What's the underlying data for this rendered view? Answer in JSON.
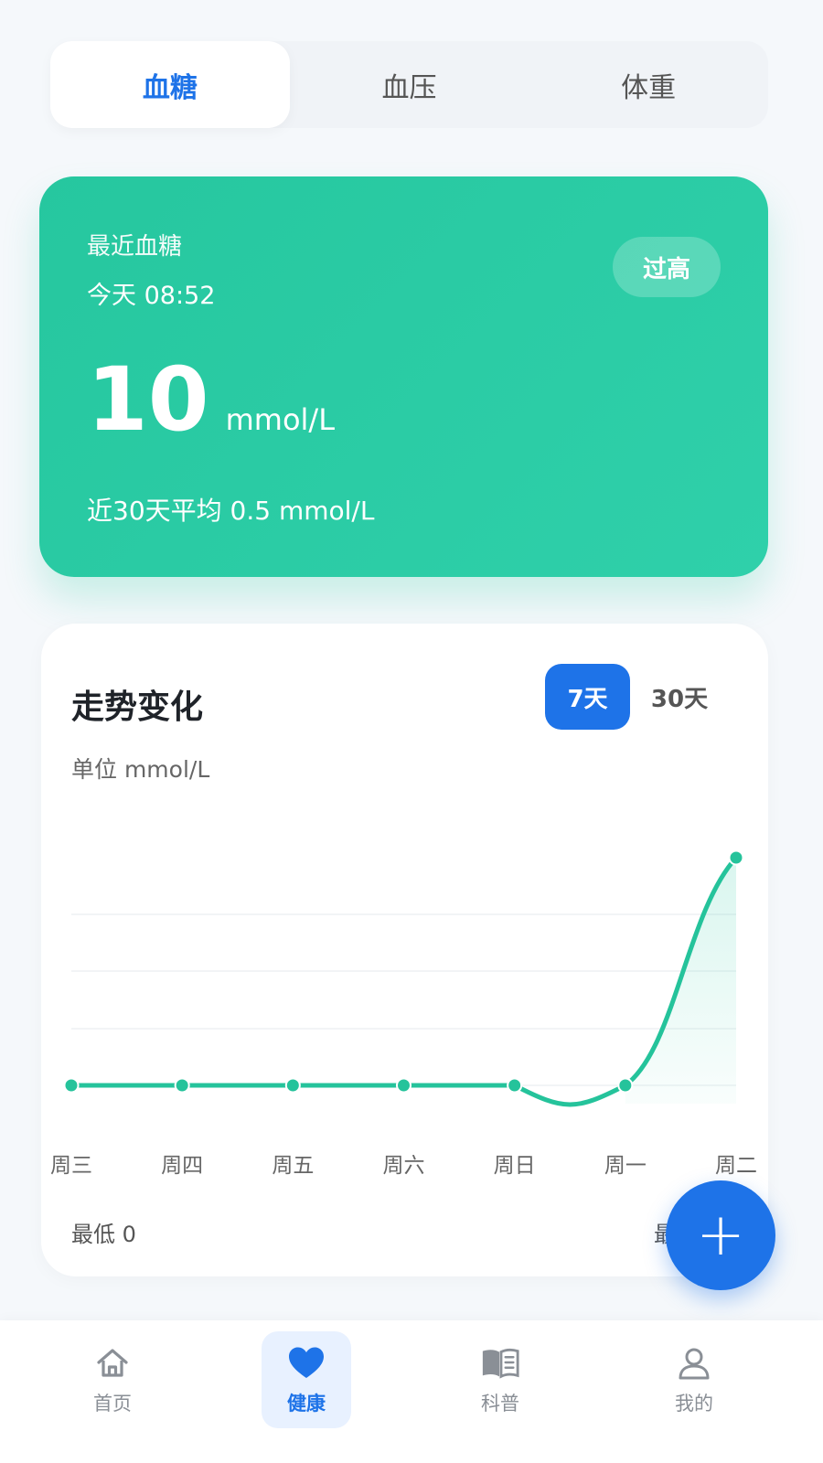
{
  "tabs": [
    {
      "label": "血糖",
      "active": true
    },
    {
      "label": "血压",
      "active": false
    },
    {
      "label": "体重",
      "active": false
    }
  ],
  "hero": {
    "title": "最近血糖",
    "time": "今天 08:52",
    "badge": "过高",
    "value": "10",
    "unit": "mmol/L",
    "average": "近30天平均 0.5 mmol/L"
  },
  "trend": {
    "title": "走势变化",
    "range_7": "7天",
    "range_30": "30天",
    "unit_label": "单位 mmol/L",
    "min_label": "最低 0",
    "max_label": "最"
  },
  "fab": {
    "label": "+"
  },
  "nav": [
    {
      "label": "首页",
      "icon": "home-icon",
      "active": false
    },
    {
      "label": "健康",
      "icon": "heart-icon",
      "active": true
    },
    {
      "label": "科普",
      "icon": "book-icon",
      "active": false
    },
    {
      "label": "我的",
      "icon": "user-icon",
      "active": false
    }
  ],
  "colors": {
    "accent": "#1e73e8",
    "health_green": "#2ecba4",
    "line": "#25c39b"
  },
  "chart_data": {
    "type": "line",
    "categories": [
      "周三",
      "周四",
      "周五",
      "周六",
      "周日",
      "周一",
      "周二"
    ],
    "series": [
      {
        "values": [
          0,
          0,
          0,
          0,
          0,
          0,
          10
        ]
      }
    ],
    "ylim": [
      -1,
      10.5
    ],
    "grid": true,
    "ylabel": "单位 mmol/L"
  }
}
